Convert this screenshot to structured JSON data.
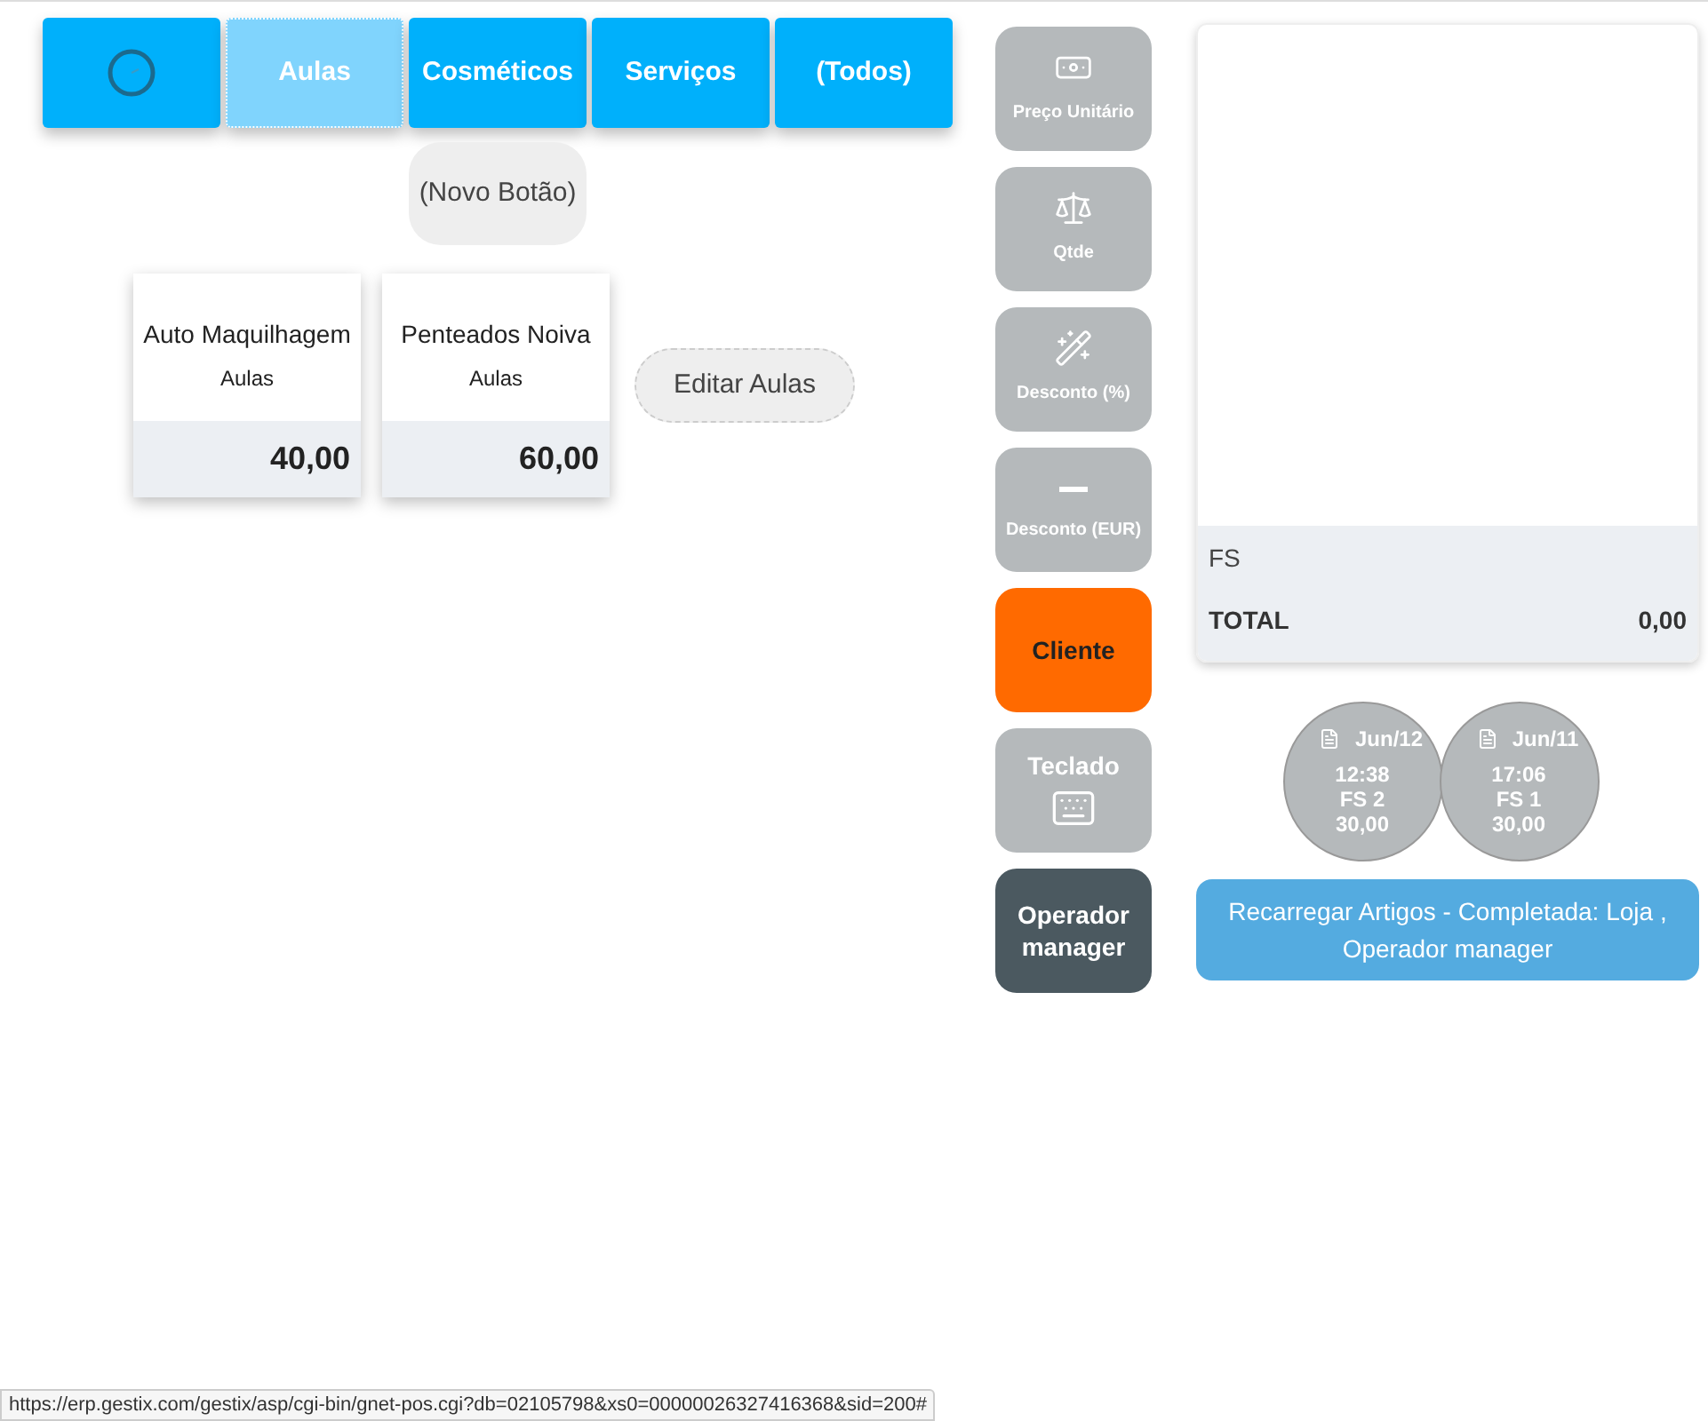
{
  "category_tabs": [
    {
      "kind": "icon",
      "selected": false
    },
    {
      "kind": "text",
      "label": "Aulas",
      "selected": true
    },
    {
      "kind": "text",
      "label": "Cosméticos",
      "selected": false
    },
    {
      "kind": "text",
      "label": "Serviços",
      "selected": false
    },
    {
      "kind": "text",
      "label": "(Todos)",
      "selected": false
    }
  ],
  "new_button": "(Novo Botão)",
  "products": [
    {
      "name": "Auto Maquilhagem",
      "category": "Aulas",
      "price": "40,00"
    },
    {
      "name": "Penteados Noiva",
      "category": "Aulas",
      "price": "60,00"
    }
  ],
  "edit_button": "Editar Aulas",
  "actions": [
    {
      "kind": "icon-top",
      "label": "Preço Unitário",
      "color": "#b5b9bb"
    },
    {
      "kind": "icon-top",
      "label": "Qtde",
      "color": "#b5b9bb"
    },
    {
      "kind": "icon-top",
      "label": "Desconto (%)",
      "color": "#b5b9bb"
    },
    {
      "kind": "icon-top",
      "label": "Desconto (EUR)",
      "color": "#b5b9bb"
    },
    {
      "kind": "label",
      "label": "Cliente",
      "color": "#ff6a00"
    },
    {
      "kind": "icon-bottom",
      "label": "Teclado",
      "color": "#b5b9bb"
    },
    {
      "kind": "label",
      "label": "Operador manager",
      "color": "#4b5960"
    }
  ],
  "receipt": {
    "doc_type": "FS",
    "total_label": "TOTAL",
    "total": "0,00"
  },
  "recent_receipts": [
    {
      "date": "Jun/12",
      "time": "12:38",
      "doc": "FS 2",
      "amount": "30,00"
    },
    {
      "date": "Jun/11",
      "time": "17:06",
      "doc": "FS 1",
      "amount": "30,00"
    }
  ],
  "notice": "Recarregar Artigos - Completada: Loja , Operador manager",
  "status_bar": "https://erp.gestix.com/gestix/asp/cgi-bin/gnet-pos.cgi?db=02105798&xs0=00000026327416368&sid=200#"
}
